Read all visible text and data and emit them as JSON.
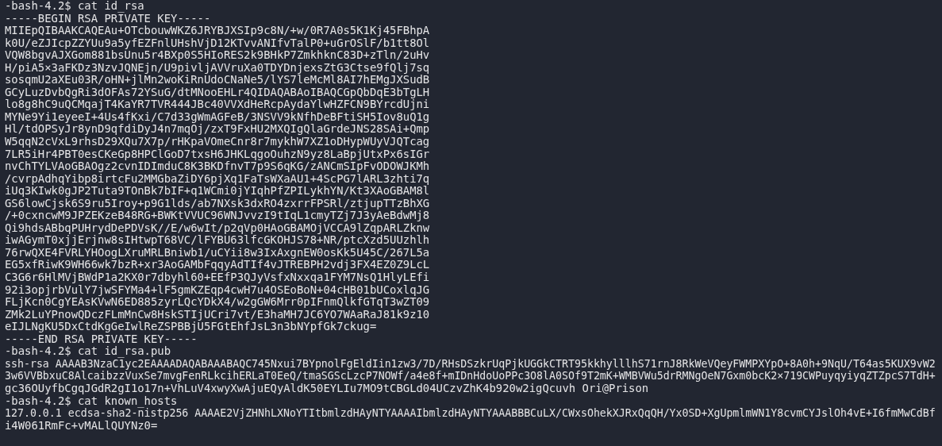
{
  "terminal": {
    "lines": [
      "-bash-4.2$ cat id_rsa",
      "-----BEGIN RSA PRIVATE KEY-----",
      "MIIEpQIBAAKCAQEAu+OTcbouwWKZ6JRYBJXSIp9c8N/+w/0R7A0s5K1Kj45FBhpA",
      "k0U/eZJIcpZZYUu9a5yfEZFnlUHshVjD12KTvvANIfvTalP0+uGrOSlF/b1tt8Ol",
      "VQW8bgvAJXGom881bsUnu5r4BXp0S5HIoRES2k9BHkP7ZmkhknC83D+zTln/2uHv",
      "H/piA5×3aFKDz3NzvJQNEjn/U9pivljAVVruXa0TDYDnjexsZtG3Ctse9fQlj7sq",
      "sosqmU2aXEu03R/oHN+jlMn2woKiRnUdoCNaNe5/lYS7leMcMl8AI7hEMgJXSudB",
      "GCyLuzDvbQgRi3dOFAs72YSuG/dtMNooEHLr4QIDAQABAoIBAQCGpQbDqE3bTgLH",
      "lo8g8hC9uQCMqajT4KaYR7TVR444JBc40VVXdHeRcpAydaYlwHZFCN9BYrcdUjni",
      "MYNe9Yi1eyeeI+4Us4fKxi/C7d33gWmAGFeB/3NSVV9kNfhDeBFtiSH5Iov8uQ1g",
      "Hl/tdOPSyJr8ynD9qfdiDyJ4n7mqOj/zxT9FxHU2MXQIgQlaGrdeJNS28SAi+Qmp",
      "W5qqN2cVxL9rhsD29XQu7X7p/rHKpaVOmeCnr8r7mykhW7XZ1oDHypWUyVJQTcag",
      "7LR5iHr4PBT0esCKeGp8HPClGoD7txsH6JHKLqgoOuhzN9yz8LaBpjUtxPx6sIGr",
      "nvChTYLVAoGBAOgz2cvnIDImduC8K3BKDfnvT7p9S6qKG/zANCmSIpFvODOWJKMh",
      "/cvrpAdhqYibp8irtcFu2MMGbaZiDY6pjXq1FaTsWXaAU1+4ScPG7lARL3zhti7q",
      "iUq3KIwk0gJP2Tuta9TOnBk7bIF+q1WCmi0jYIqhPfZPILykhYN/Kt3XAoGBAM8l",
      "GS6lowCjsk6S9ru5Iroy+p9G1lds/ab7NXsk3dxRO4zxrrFPSRl/ztjupTTzBhXG",
      "/+0cxncwM9JPZEKzeB48RG+BWKtVVUC96WNJvvzI9tIqL1cmyTZj7J3yAeBdwMj8",
      "Qi9hdsABbqPUHrydDePDVsK//E/w6wIt/p2qVp0HAoGBAMOjVCCA9lZqpARLZknw",
      "iwAGymT0xjjErjnw8sIHtwpT68VC/lFYBU63lfcGKOHJS78+NR/ptcXzd5UUzhlh",
      "76rwQXE4FVRLYHOogLXruMRLBniwb1/uCYii8w3IxAxgnEW0osKk5U45C/267L5a",
      "EG5xfRiwK9WH66wk7bzR+xr3AoGAMbFqqyAdTIf4vJTREBPH2vdj3FX4EZ0Z9LcL",
      "C3G6r6HlMVjBWdP1a2KX0r7dbyhl60+EEfP3QJyVsfxNxxqa1FYM7NsQ1HlyLEfi",
      "92i3opjrbVulY7jwSFYMa4+lF5gmKZEqp4cwH7u4OSEoBoN+04cHB01bUCoxlqJG",
      "FLjKcn0CgYEAsKVwN6ED885zyrLQcYDkX4/w2gGW6Mrr0pIFnmQlkfGTqT3wZT09",
      "ZMk2LuYPnowQDczFLmMnCw8HskSTIjUCri7vt/E3haMH7JC6YO7WAaRaJ81k9z10",
      "eIJLNgKU5DxCtdKgGeIwlReZSPBBjU5FGtEhfJsL3n3bNYpfGk7ckug=",
      "-----END RSA PRIVATE KEY-----",
      "-bash-4.2$ cat id_rsa.pub",
      "ssh-rsa AAAAB3NzaC1yc2EAAAADAQABAAABAQC745Nxui7BYpnolFgEldIin1zw3/7D/RHsDSzkrUqPjkUGGkCTRT95kkhylllhS71rnJ8RkWeVQeyFWMPXYpO+8A0h+9NqU/T64as5KUX9vW2",
      "3w6VVBbxuC8AlcaibzzVuxSe7mvgFenRLkcihERLaT0EeQ/tmaSGScLzcP7NOWf/a4e8f+mIDnHdoUoPPc3O8lA0SOf9T2mK+WMBVWu5drRMNgOeN7Gxm0bcK2×719CWPuyqyiyqZTZpcS7TdH+",
      "gc36OUyfbCgqJGdR2gI1o17n+VhLuV4xwyXwAjuEQyAldK50EYLIu7MO9tCBGLd04UCzvZhK4b920w2igQcuvh Ori@Prison",
      "-bash-4.2$ cat known_hosts",
      "127.0.0.1 ecdsa-sha2-nistp256 AAAAE2VjZHNhLXNoYTItbmlzdHAyNTYAAAAIbmlzdHAyNTYAAABBBCuLX/CWxsOhekXJRxQqQH/Yx0SD+XgUpmlmWN1Y8cvmCYJslOh4vE+I6fmMwCdBf",
      "i4W061RmFc+vMALlQUYNz0="
    ]
  }
}
